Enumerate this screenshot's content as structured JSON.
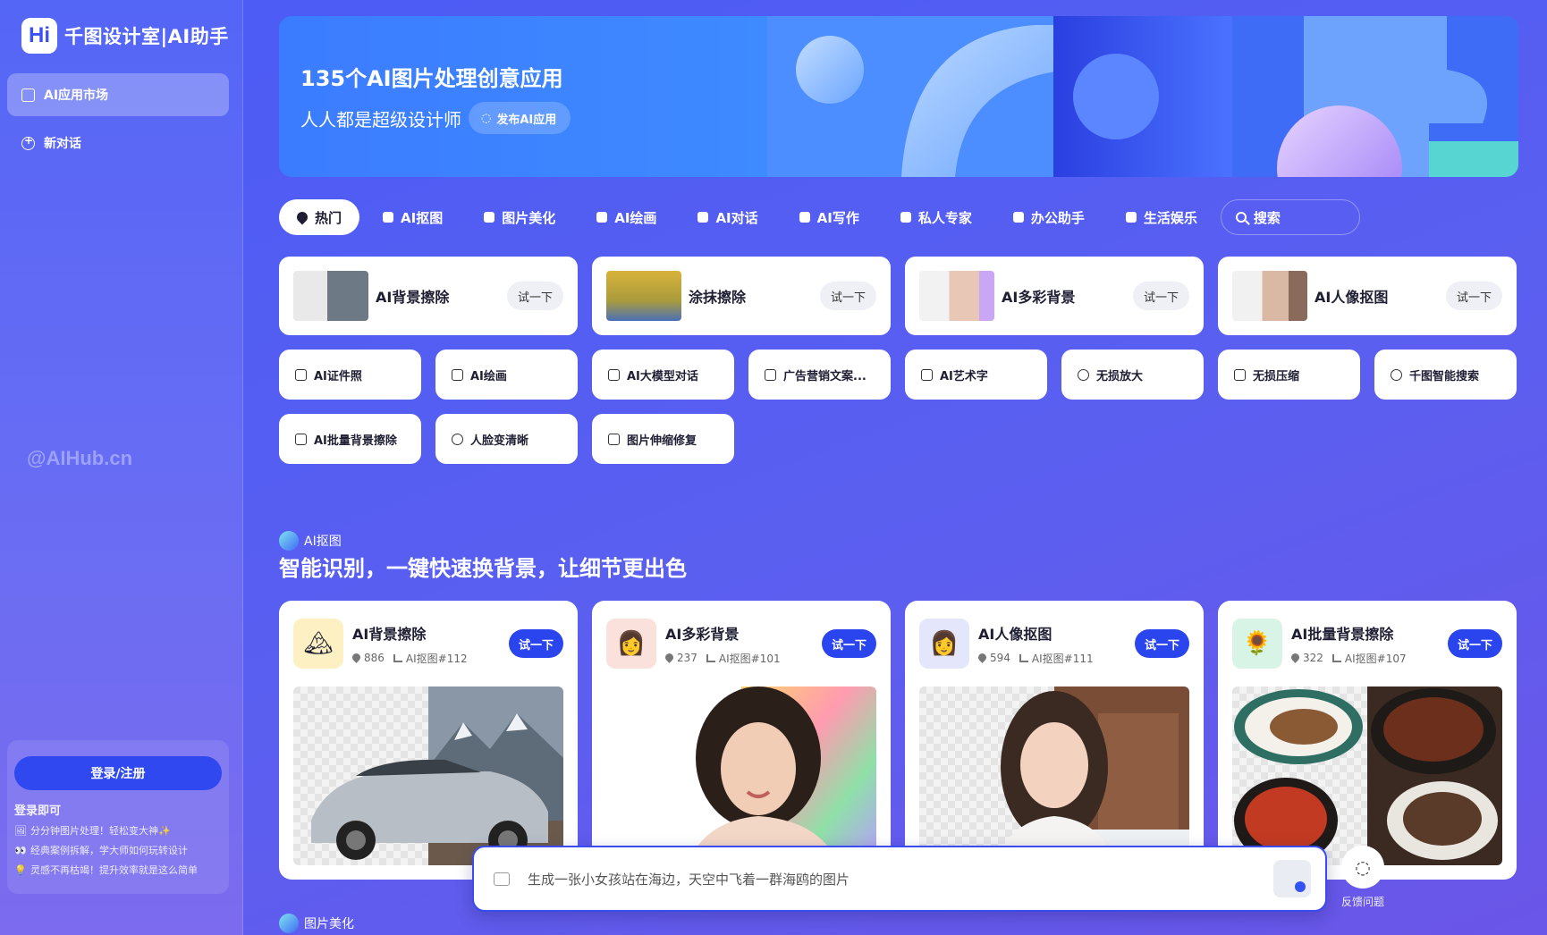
{
  "sidebar": {
    "logo_mark": "Hi",
    "logo_text": "千图设计室|AI助手",
    "items": [
      {
        "label": "AI应用市场",
        "icon": "grid-icon",
        "active": true
      },
      {
        "label": "新对话",
        "icon": "plus-circle-icon",
        "active": false
      }
    ],
    "watermark": "@AIHub.cn",
    "login": {
      "button": "登录/注册",
      "title": "登录即可",
      "lines": [
        {
          "emoji": "🖼",
          "text": "分分钟图片处理！轻松变大神✨"
        },
        {
          "emoji": "👀",
          "text": "经典案例拆解，学大师如何玩转设计"
        },
        {
          "emoji": "💡",
          "text": "灵感不再枯竭！提升效率就是这么简单"
        }
      ]
    }
  },
  "banner": {
    "title": "135个AI图片处理创意应用",
    "subtitle": "人人都是超级设计师",
    "publish_button": "发布AI应用"
  },
  "tabs": [
    {
      "label": "热门",
      "icon": "fire-icon",
      "active": true
    },
    {
      "label": "AI抠图",
      "icon": "cutout-icon"
    },
    {
      "label": "图片美化",
      "icon": "beauty-icon"
    },
    {
      "label": "AI绘画",
      "icon": "image-icon"
    },
    {
      "label": "AI对话",
      "icon": "chat-icon"
    },
    {
      "label": "AI写作",
      "icon": "book-icon"
    },
    {
      "label": "私人专家",
      "icon": "person-icon"
    },
    {
      "label": "办公助手",
      "icon": "dashboard-icon"
    },
    {
      "label": "生活娱乐",
      "icon": "smile-icon"
    }
  ],
  "search": {
    "label": "搜索"
  },
  "featured": [
    {
      "name": "AI背景擦除",
      "button": "试一下"
    },
    {
      "name": "涂抹擦除",
      "button": "试一下"
    },
    {
      "name": "AI多彩背景",
      "button": "试一下"
    },
    {
      "name": "AI人像抠图",
      "button": "试一下"
    }
  ],
  "tools": [
    {
      "label": "AI证件照",
      "icon": "id-card-icon"
    },
    {
      "label": "AI绘画",
      "icon": "flask-icon"
    },
    {
      "label": "AI大模型对话",
      "icon": "model-icon"
    },
    {
      "label": "广告营销文案...",
      "icon": "ad-icon"
    },
    {
      "label": "AI艺术字",
      "icon": "art-text-icon"
    },
    {
      "label": "无损放大",
      "icon": "zoom-in-icon"
    },
    {
      "label": "无损压缩",
      "icon": "compress-icon"
    },
    {
      "label": "千图智能搜索",
      "icon": "search-icon"
    },
    {
      "label": "AI批量背景擦除",
      "icon": "batch-icon"
    },
    {
      "label": "人脸变清晰",
      "icon": "face-icon"
    },
    {
      "label": "图片伸缩修复",
      "icon": "resize-icon"
    }
  ],
  "section": {
    "tag": "AI抠图",
    "title": "智能识别，一键快速换背景，让细节更出色"
  },
  "demos": [
    {
      "name": "AI背景擦除",
      "count": "886",
      "code": "AI抠图#112",
      "button": "试一下",
      "icon_bg": "#fdf1c4",
      "icon_glyph": "🏔"
    },
    {
      "name": "AI多彩背景",
      "count": "237",
      "code": "AI抠图#101",
      "button": "试一下",
      "icon_bg": "#fbe1dc",
      "icon_glyph": "👩"
    },
    {
      "name": "AI人像抠图",
      "count": "594",
      "code": "AI抠图#111",
      "button": "试一下",
      "icon_bg": "#e4e6fb",
      "icon_glyph": "👩"
    },
    {
      "name": "AI批量背景擦除",
      "count": "322",
      "code": "AI抠图#107",
      "button": "试一下",
      "icon_bg": "#d8f4e6",
      "icon_glyph": "🌻"
    }
  ],
  "prompt": {
    "text": "生成一张小女孩站在海边，天空中飞着一群海鸥的图片"
  },
  "feedback": {
    "label": "反馈问题"
  },
  "next_section_tag": "图片美化"
}
